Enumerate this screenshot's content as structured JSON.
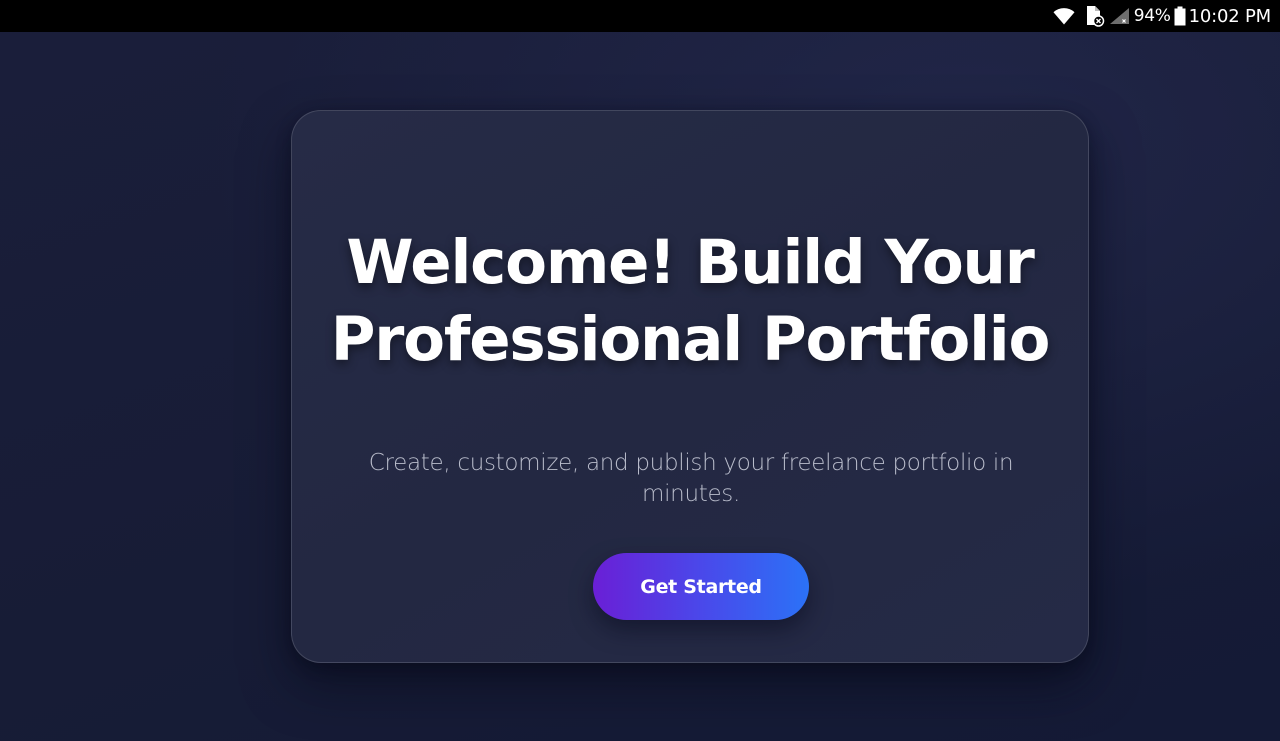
{
  "status_bar": {
    "battery_percent": "94%",
    "time": "10:02 PM",
    "icons": [
      "wifi-icon",
      "file-blocked-icon",
      "signal-icon",
      "battery-icon"
    ]
  },
  "hero": {
    "title": "Welcome! Build Your Professional Portfolio",
    "subtitle": "Create, customize, and publish your freelance portfolio in minutes.",
    "cta_label": "Get Started"
  },
  "colors": {
    "background": "#181d38",
    "card": "#242944",
    "title": "#ffffff",
    "subtitle": "#b9bccb",
    "cta_gradient_start": "#6a1fd6",
    "cta_gradient_end": "#2b72f7"
  }
}
